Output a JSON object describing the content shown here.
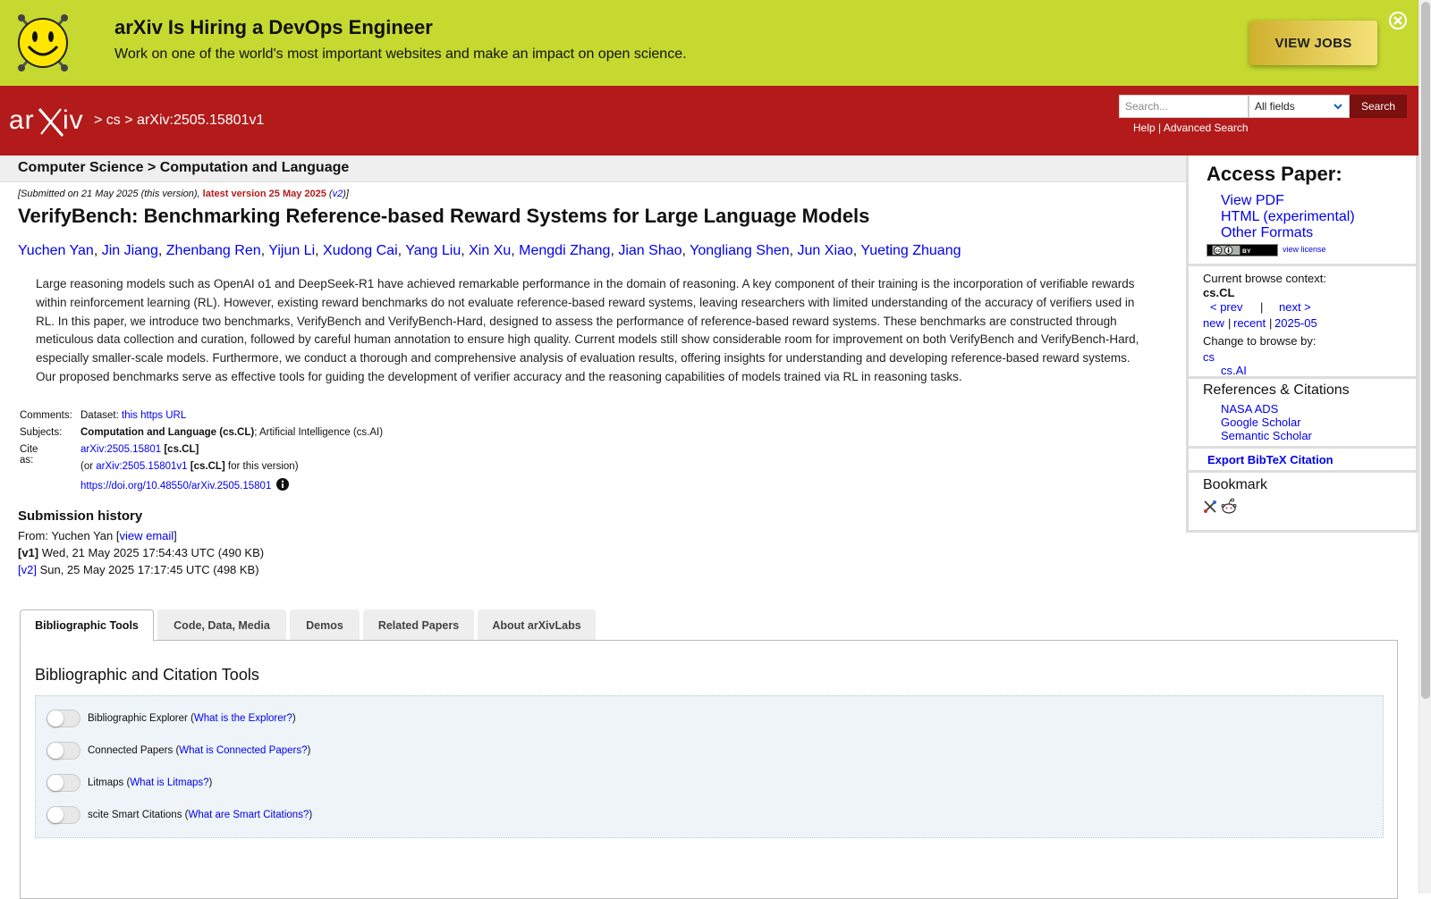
{
  "banner": {
    "title": "arXiv Is Hiring a DevOps Engineer",
    "subtitle": "Work on one of the world's most important websites and make an impact on open science.",
    "cta_label": "VIEW JOBS",
    "icons": {
      "mascot": "smiley-icon",
      "close": "close-icon"
    }
  },
  "header": {
    "crumbs": [
      ">",
      "cs",
      ">",
      "arXiv:2505.15801v1"
    ],
    "search": {
      "placeholder": "Search...",
      "field_selected": "All fields",
      "button_label": "Search"
    },
    "help_label": "Help",
    "help_sep": "|",
    "advanced_label": "Advanced Search"
  },
  "subject_bar": {
    "text": "Computer Science > Computation and Language"
  },
  "submitted": {
    "prefix": "[Submitted on 21 May 2025 (this version), ",
    "latest": "latest version 25 May 2025",
    "open": " (",
    "v2": "v2",
    "close": ")]"
  },
  "paper": {
    "title": "VerifyBench: Benchmarking Reference-based Reward Systems for Large Language Models",
    "authors": [
      "Yuchen Yan",
      "Jin Jiang",
      "Zhenbang Ren",
      "Yijun Li",
      "Xudong Cai",
      "Yang Liu",
      "Xin Xu",
      "Mengdi Zhang",
      "Jian Shao",
      "Yongliang Shen",
      "Jun Xiao",
      "Yueting Zhuang"
    ],
    "abstract": "Large reasoning models such as OpenAI o1 and DeepSeek-R1 have achieved remarkable performance in the domain of reasoning. A key component of their training is the incorporation of verifiable rewards within reinforcement learning (RL). However, existing reward benchmarks do not evaluate reference-based reward systems, leaving researchers with limited understanding of the accuracy of verifiers used in RL. In this paper, we introduce two benchmarks, VerifyBench and VerifyBench-Hard, designed to assess the performance of reference-based reward systems. These benchmarks are constructed through meticulous data collection and curation, followed by careful human annotation to ensure high quality. Current models still show considerable room for improvement on both VerifyBench and VerifyBench-Hard, especially smaller-scale models. Furthermore, we conduct a thorough and comprehensive analysis of evaluation results, offering insights for understanding and developing reference-based reward systems. Our proposed benchmarks serve as effective tools for guiding the development of verifier accuracy and the reasoning capabilities of models trained via RL in reasoning tasks."
  },
  "meta": {
    "comments_label": "Comments:",
    "comments_prefix": "Dataset: ",
    "comments_link": "this https URL",
    "subjects_label": "Subjects:",
    "subjects_primary": "Computation and Language (cs.CL)",
    "subjects_rest": "; Artificial Intelligence (cs.AI)",
    "cite_label": "Cite as:",
    "cite_id": "arXiv:2505.15801",
    "cite_tag": " [cs.CL]",
    "cite2_prefix": "(or ",
    "cite2_id": "arXiv:2505.15801v1",
    "cite2_tag": " [cs.CL]",
    "cite2_suffix": " for this version)",
    "doi": "https://doi.org/10.48550/arXiv.2505.15801"
  },
  "history": {
    "title": "Submission history",
    "from_prefix": "From: Yuchen Yan [",
    "from_link": "view email",
    "from_suffix": "]",
    "v1_label": "[v1]",
    "v1_text": " Wed, 21 May 2025 17:54:43 UTC (490 KB)",
    "v2_label": "[v2]",
    "v2_text": " Sun, 25 May 2025 17:17:45 UTC (498 KB)"
  },
  "sidebar": {
    "access_title": "Access Paper:",
    "view_pdf": "View PDF",
    "html": "HTML (experimental)",
    "other_formats": "Other Formats",
    "license_badge": "cc-by-icon",
    "view_license": "view license",
    "context_label": "Current browse context:",
    "context_value": "cs.CL",
    "prev": "< prev",
    "nav_sep": "|",
    "next": "next >",
    "new": "new",
    "recent": "recent",
    "month": "2025-05",
    "browse_by": "Change to browse by:",
    "browse_cs": "cs",
    "browse_csai": "cs.AI",
    "refs_title": "References & Citations",
    "nasa": "NASA ADS",
    "scholar": "Google Scholar",
    "semantic": "Semantic Scholar",
    "bibtex": "Export BibTeX Citation",
    "bookmark": "Bookmark"
  },
  "tabs": [
    "Bibliographic Tools",
    "Code, Data, Media",
    "Demos",
    "Related Papers",
    "About arXivLabs"
  ],
  "labs": {
    "title": "Bibliographic and Citation Tools",
    "tools": [
      {
        "name": "Bibliographic Explorer",
        "link": "What is the Explorer?"
      },
      {
        "name": "Connected Papers",
        "link": "What is Connected Papers?"
      },
      {
        "name": "Litmaps",
        "link": "What is Litmaps?"
      },
      {
        "name": "scite Smart Citations",
        "link": "What are Smart Citations?"
      }
    ]
  },
  "colors": {
    "banner": "#c5d930",
    "header": "#b31b1b",
    "link": "#0000ee"
  }
}
